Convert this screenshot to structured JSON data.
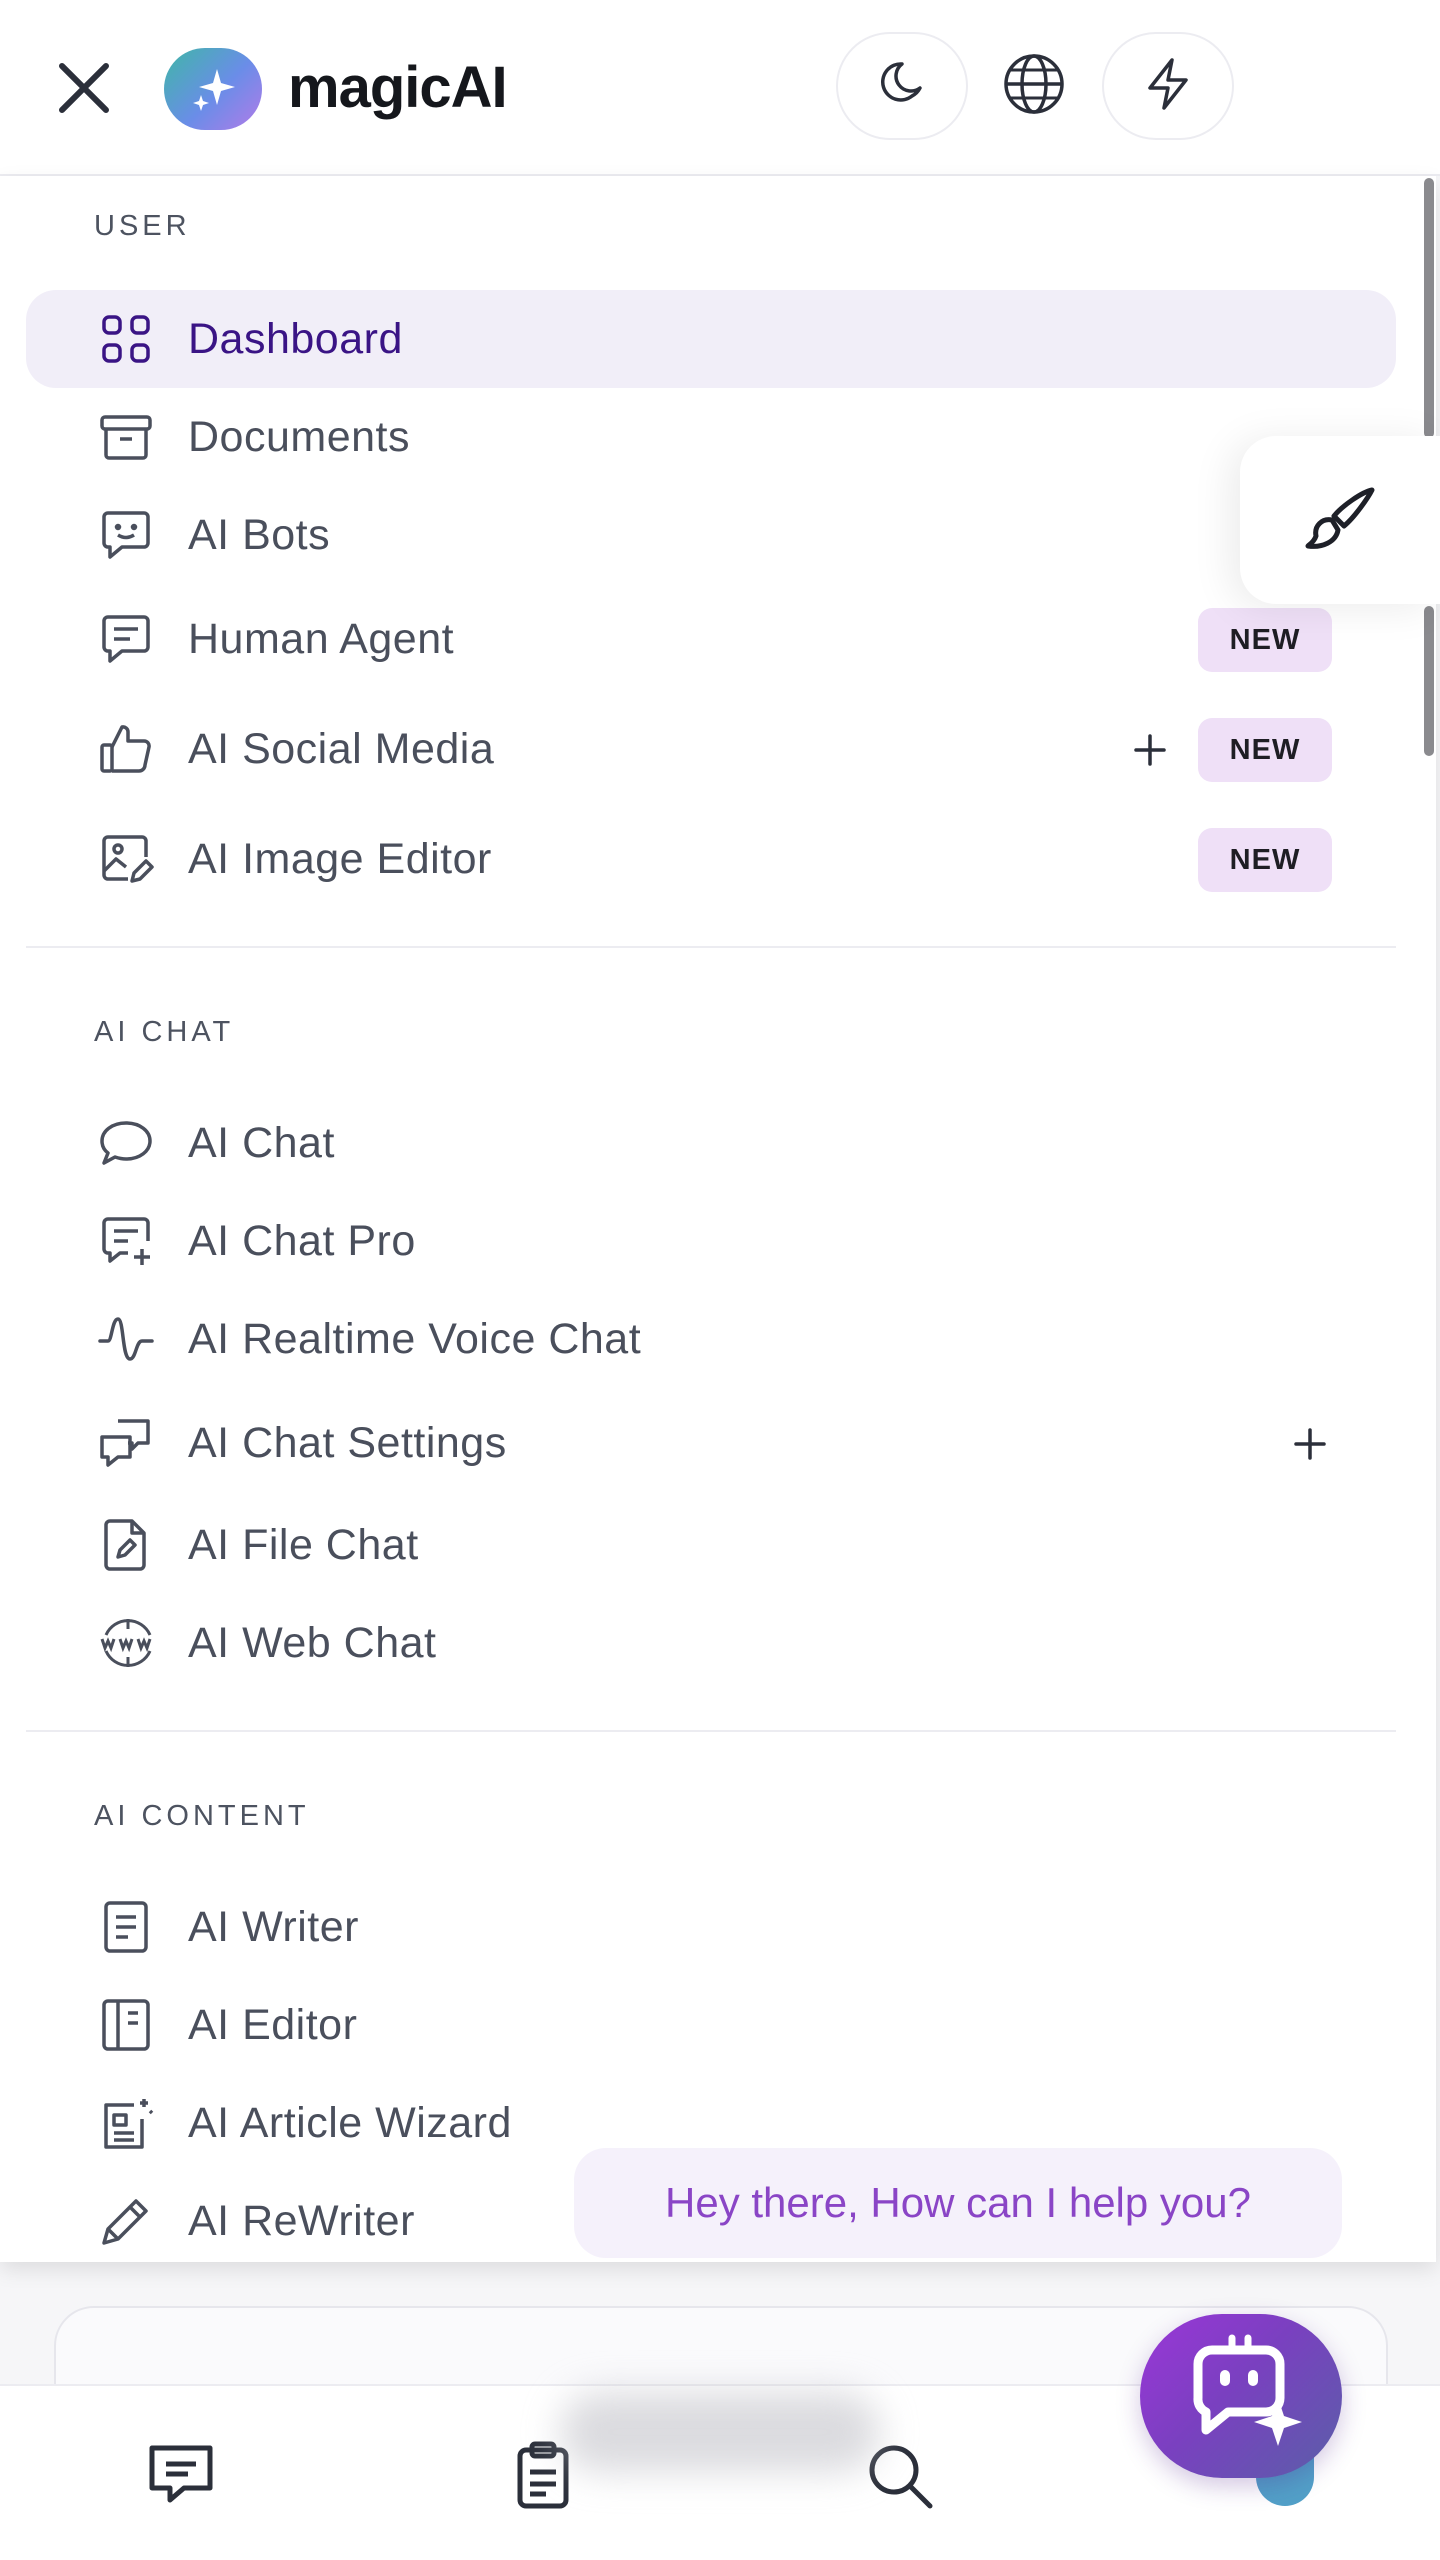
{
  "header": {
    "logo_text": "magicAI"
  },
  "sections": [
    {
      "title": "USER",
      "items": [
        {
          "label": "Dashboard",
          "icon": "grid-icon",
          "active": true
        },
        {
          "label": "Documents",
          "icon": "archive-icon"
        },
        {
          "label": "AI Bots",
          "icon": "bot-chat-icon"
        },
        {
          "label": "Human Agent",
          "icon": "message-icon",
          "badge": "NEW"
        },
        {
          "label": "AI Social Media",
          "icon": "thumbs-up-icon",
          "badge": "NEW",
          "expandable": true
        },
        {
          "label": "AI Image Editor",
          "icon": "image-edit-icon",
          "badge": "NEW"
        }
      ]
    },
    {
      "title": "AI CHAT",
      "items": [
        {
          "label": "AI Chat",
          "icon": "chat-bubble-icon"
        },
        {
          "label": "AI Chat Pro",
          "icon": "chat-plus-icon"
        },
        {
          "label": "AI Realtime Voice Chat",
          "icon": "wave-icon"
        },
        {
          "label": "AI Chat Settings",
          "icon": "chat-settings-icon",
          "expandable": true
        },
        {
          "label": "AI File Chat",
          "icon": "file-edit-icon"
        },
        {
          "label": "AI Web Chat",
          "icon": "www-globe-icon"
        }
      ]
    },
    {
      "title": "AI CONTENT",
      "items": [
        {
          "label": "AI Writer",
          "icon": "document-lines-icon"
        },
        {
          "label": "AI Editor",
          "icon": "book-icon"
        },
        {
          "label": "AI Article Wizard",
          "icon": "article-wizard-icon"
        },
        {
          "label": "AI ReWriter",
          "icon": "pencil-icon"
        }
      ]
    }
  ],
  "chat_bubble": {
    "text": "Hey there, How can I help you?"
  },
  "colors": {
    "accent": "#3a1485",
    "active_bg": "#f1eef8",
    "badge_bg": "#efe0f7",
    "bubble_text": "#8a45c6"
  }
}
